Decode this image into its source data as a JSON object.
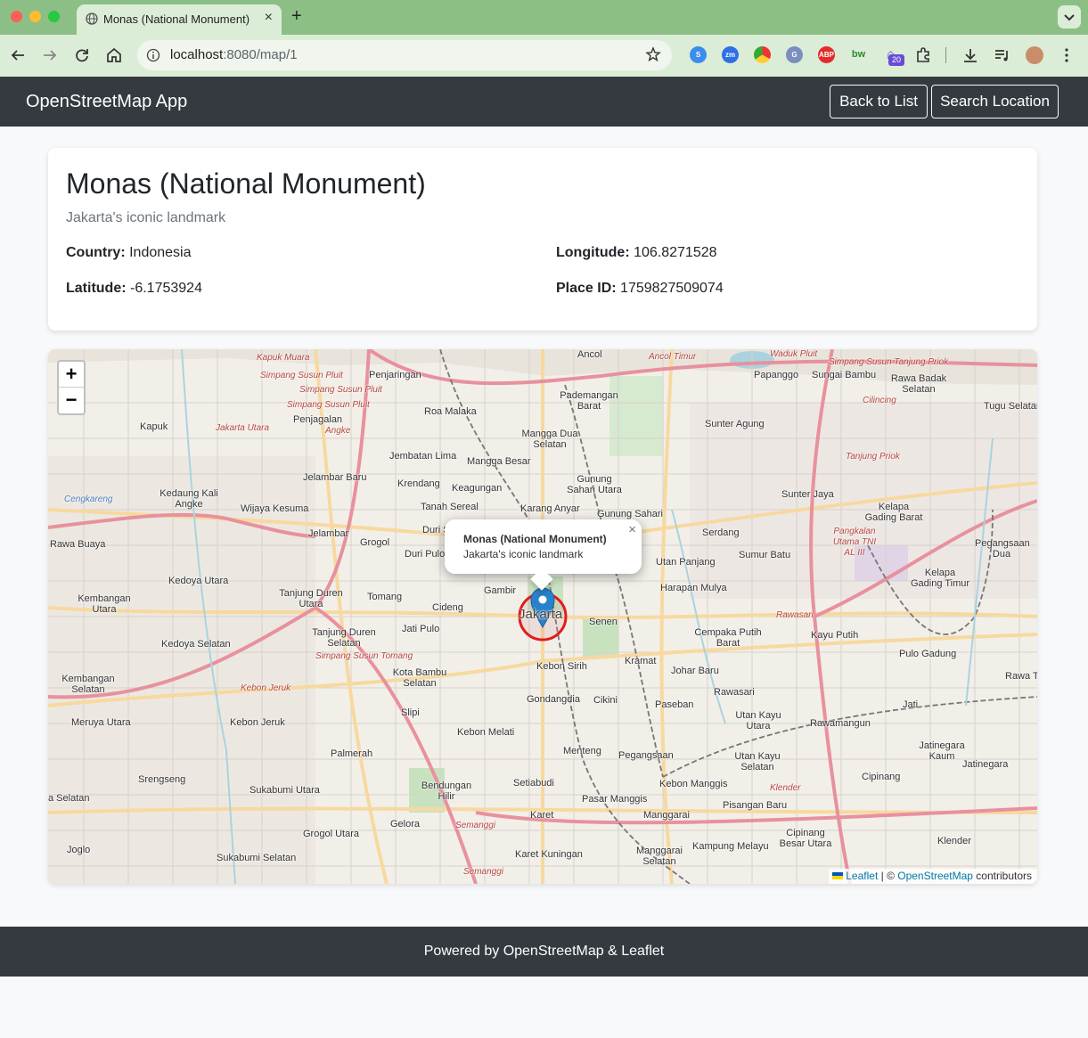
{
  "browser": {
    "tab_title": "Monas (National Monument)",
    "url_host": "localhost",
    "url_path": ":8080/map/1",
    "extension_badge": "20"
  },
  "navbar": {
    "brand": "OpenStreetMap App",
    "back_label": "Back to List",
    "search_label": "Search Location"
  },
  "place": {
    "title": "Monas (National Monument)",
    "subtitle": "Jakarta's iconic landmark",
    "country_label": "Country:",
    "country": "Indonesia",
    "latitude_label": "Latitude:",
    "latitude": "-6.1753924",
    "longitude_label": "Longitude:",
    "longitude": "106.8271528",
    "place_id_label": "Place ID:",
    "place_id": "1759827509074"
  },
  "map": {
    "zoom_in": "+",
    "zoom_out": "−",
    "popup_title": "Monas (National Monument)",
    "popup_desc": "Jakarta's iconic landmark",
    "popup_close": "×",
    "center_label": "Jakarta",
    "attribution": {
      "leaflet": "Leaflet",
      "separator": " | © ",
      "osm": "OpenStreetMap",
      "suffix": " contributors"
    },
    "labels": [
      "Ancol",
      "Penjaringan",
      "Pademangan Barat",
      "Papanggo",
      "Sungai Bambu",
      "Rawa Badak Selatan",
      "Tugu Selatan",
      "Kapuk",
      "Penjagalan",
      "Roa Malaka",
      "Mangga Dua Selatan",
      "Sunter Agung",
      "Jembatan Lima",
      "Mangga Besar",
      "Gunung Sahari Utara",
      "Kedaung Kali Angke",
      "Jelambar Baru",
      "Krendang",
      "Keagungan",
      "Wijaya Kesuma",
      "Jelambar",
      "Tanah Sereal",
      "Karang Anyar",
      "Gunung Sahari",
      "Sunter Jaya",
      "Kelapa Gading Barat",
      "Rawa Buaya",
      "Grogol",
      "Duri Selatan",
      "Duri Pulo",
      "Serdang",
      "Sumur Batu",
      "Pegangsaan Dua",
      "Kedoya Utara",
      "Tanjung Duren Utara",
      "Tomang",
      "Gambir",
      "Utan Panjang",
      "Harapan Mulya",
      "Kelapa Gading Timur",
      "Kembangan Utara",
      "Cideng",
      "Senen",
      "Cempaka Putih Barat",
      "Kayu Putih",
      "Jati Pulo",
      "Tanjung Duren Selatan",
      "Kedoya Selatan",
      "Kebon Sirih",
      "Kramat",
      "Johar Baru",
      "Pulo Gadung",
      "Kembangan Selatan",
      "Kota Bambu Selatan",
      "Gondangdia",
      "Cikini",
      "Rawasari",
      "Meruya Utara",
      "Kebon Jeruk",
      "Slipi",
      "Paseban",
      "Utan Kayu Utara",
      "Rawamangun",
      "Jati",
      "Kebon Melati",
      "Menteng",
      "Pegangsaan",
      "Utan Kayu Selatan",
      "Jatinegara Kaum",
      "Palmerah",
      "Jatinegara",
      "Srengseng",
      "Sukabumi Utara",
      "Bendungan Hilir",
      "Setiabudi",
      "Kebon Manggis",
      "Pasar Manggis",
      "Cipinang",
      "Gelora",
      "Grogol Utara",
      "Karet",
      "Manggarai",
      "Pisangan Baru",
      "Joglo",
      "Sukabumi Selatan",
      "Karet Kuningan",
      "Manggarai Selatan",
      "Kampung Melayu",
      "Cipinang Besar Utara",
      "Klender",
      "Rawa T",
      "a Selatan"
    ],
    "road_labels": [
      "Kapuk Muara",
      "Simpang Susun Pluit",
      "Simpang Susun Pluit",
      "Simpang Susun Pluit",
      "Angke",
      "Jakarta Utara",
      "Cengkareng",
      "Simpang Susun Tomang",
      "Kebon Jeruk",
      "Rawasari",
      "Klender",
      "Semanggi",
      "Semanggi",
      "Pangkalan Utama TNI AL III",
      "Tanjung Priok",
      "Simpang Susun Tanjung Priok",
      "Ancol Timur",
      "Cilincing",
      "Waduk Pluit"
    ]
  },
  "footer": {
    "text": "Powered by OpenStreetMap & Leaflet"
  }
}
